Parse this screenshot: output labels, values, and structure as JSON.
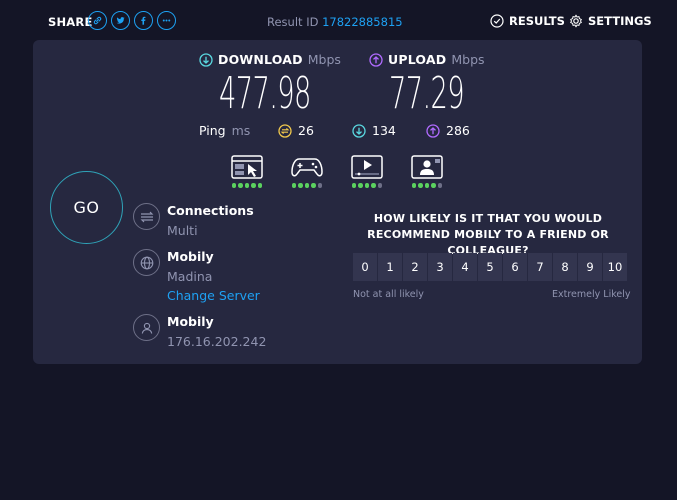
{
  "header": {
    "share_label": "SHARE",
    "share_icons": [
      "link-icon",
      "twitter-icon",
      "facebook-icon",
      "more-icon"
    ],
    "result_id_label": "Result ID",
    "result_id_value": "17822885815",
    "results_label": "RESULTS",
    "settings_label": "SETTINGS"
  },
  "download": {
    "title": "DOWNLOAD",
    "unit": "Mbps",
    "value": "477.98",
    "color": "#5ad8e0"
  },
  "upload": {
    "title": "UPLOAD",
    "unit": "Mbps",
    "value": "77.29",
    "color": "#b06bff"
  },
  "ping": {
    "label": "Ping",
    "unit": "ms",
    "idle": "26",
    "download": "134",
    "upload": "286",
    "idle_color": "#f2c94c"
  },
  "usecases": [
    {
      "icon": "web-browsing-icon",
      "rating": 5
    },
    {
      "icon": "gaming-icon",
      "rating": 4
    },
    {
      "icon": "video-streaming-icon",
      "rating": 4
    },
    {
      "icon": "video-chat-icon",
      "rating": 4
    }
  ],
  "go_label": "GO",
  "connections": {
    "title": "Connections",
    "value": "Multi"
  },
  "server": {
    "title": "Mobily",
    "location": "Madina",
    "change_label": "Change Server"
  },
  "provider": {
    "title": "Mobily",
    "ip": "176.16.202.242"
  },
  "survey": {
    "question": "HOW LIKELY IS IT THAT YOU WOULD RECOMMEND MOBILY TO A FRIEND OR COLLEAGUE?",
    "scale": [
      "0",
      "1",
      "2",
      "3",
      "4",
      "5",
      "6",
      "7",
      "8",
      "9",
      "10"
    ],
    "low_label": "Not at all likely",
    "high_label": "Extremely Likely"
  },
  "colors": {
    "accent": "#1ea1f3",
    "panel": "#262840",
    "background": "#141526",
    "rating_on": "#5bd25f"
  }
}
